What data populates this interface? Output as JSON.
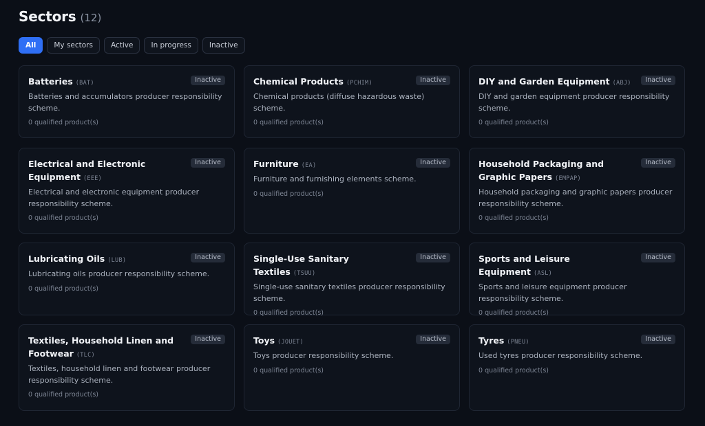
{
  "header": {
    "title": "Sectors",
    "count": "(12)"
  },
  "filters": [
    {
      "label": "All",
      "active": true
    },
    {
      "label": "My sectors",
      "active": false
    },
    {
      "label": "Active",
      "active": false
    },
    {
      "label": "In progress",
      "active": false
    },
    {
      "label": "Inactive",
      "active": false
    }
  ],
  "colors": {
    "accent": "#2f6ff5",
    "background": "#0b0f17",
    "card": "#0e131c",
    "badge": "#252c39"
  },
  "sectors": [
    {
      "name": "Batteries",
      "code": "(BAT)",
      "status": "Inactive",
      "description": "Batteries and accumulators producer responsibility scheme.",
      "products": "0 qualified product(s)"
    },
    {
      "name": "Chemical Products",
      "code": "(PCHIM)",
      "status": "Inactive",
      "description": "Chemical products (diffuse hazardous waste) scheme.",
      "products": "0 qualified product(s)"
    },
    {
      "name": "DIY and Garden Equipment",
      "code": "(ABJ)",
      "status": "Inactive",
      "description": "DIY and garden equipment producer responsibility scheme.",
      "products": "0 qualified product(s)"
    },
    {
      "name": "Electrical and Electronic Equipment",
      "code": "(EEE)",
      "status": "Inactive",
      "description": "Electrical and electronic equipment producer responsibility scheme.",
      "products": "0 qualified product(s)"
    },
    {
      "name": "Furniture",
      "code": "(EA)",
      "status": "Inactive",
      "description": "Furniture and furnishing elements scheme.",
      "products": "0 qualified product(s)"
    },
    {
      "name": "Household Packaging and Graphic Papers",
      "code": "(EMPAP)",
      "status": "Inactive",
      "description": "Household packaging and graphic papers producer responsibility scheme.",
      "products": "0 qualified product(s)"
    },
    {
      "name": "Lubricating Oils",
      "code": "(LUB)",
      "status": "Inactive",
      "description": "Lubricating oils producer responsibility scheme.",
      "products": "0 qualified product(s)"
    },
    {
      "name": "Single-Use Sanitary Textiles",
      "code": "(TSUU)",
      "status": "Inactive",
      "description": "Single-use sanitary textiles producer responsibility scheme.",
      "products": "0 qualified product(s)"
    },
    {
      "name": "Sports and Leisure Equipment",
      "code": "(ASL)",
      "status": "Inactive",
      "description": "Sports and leisure equipment producer responsibility scheme.",
      "products": "0 qualified product(s)"
    },
    {
      "name": "Textiles, Household Linen and Footwear",
      "code": "(TLC)",
      "status": "Inactive",
      "description": "Textiles, household linen and footwear producer responsibility scheme.",
      "products": "0 qualified product(s)"
    },
    {
      "name": "Toys",
      "code": "(JOUET)",
      "status": "Inactive",
      "description": "Toys producer responsibility scheme.",
      "products": "0 qualified product(s)"
    },
    {
      "name": "Tyres",
      "code": "(PNEU)",
      "status": "Inactive",
      "description": "Used tyres producer responsibility scheme.",
      "products": "0 qualified product(s)"
    }
  ]
}
